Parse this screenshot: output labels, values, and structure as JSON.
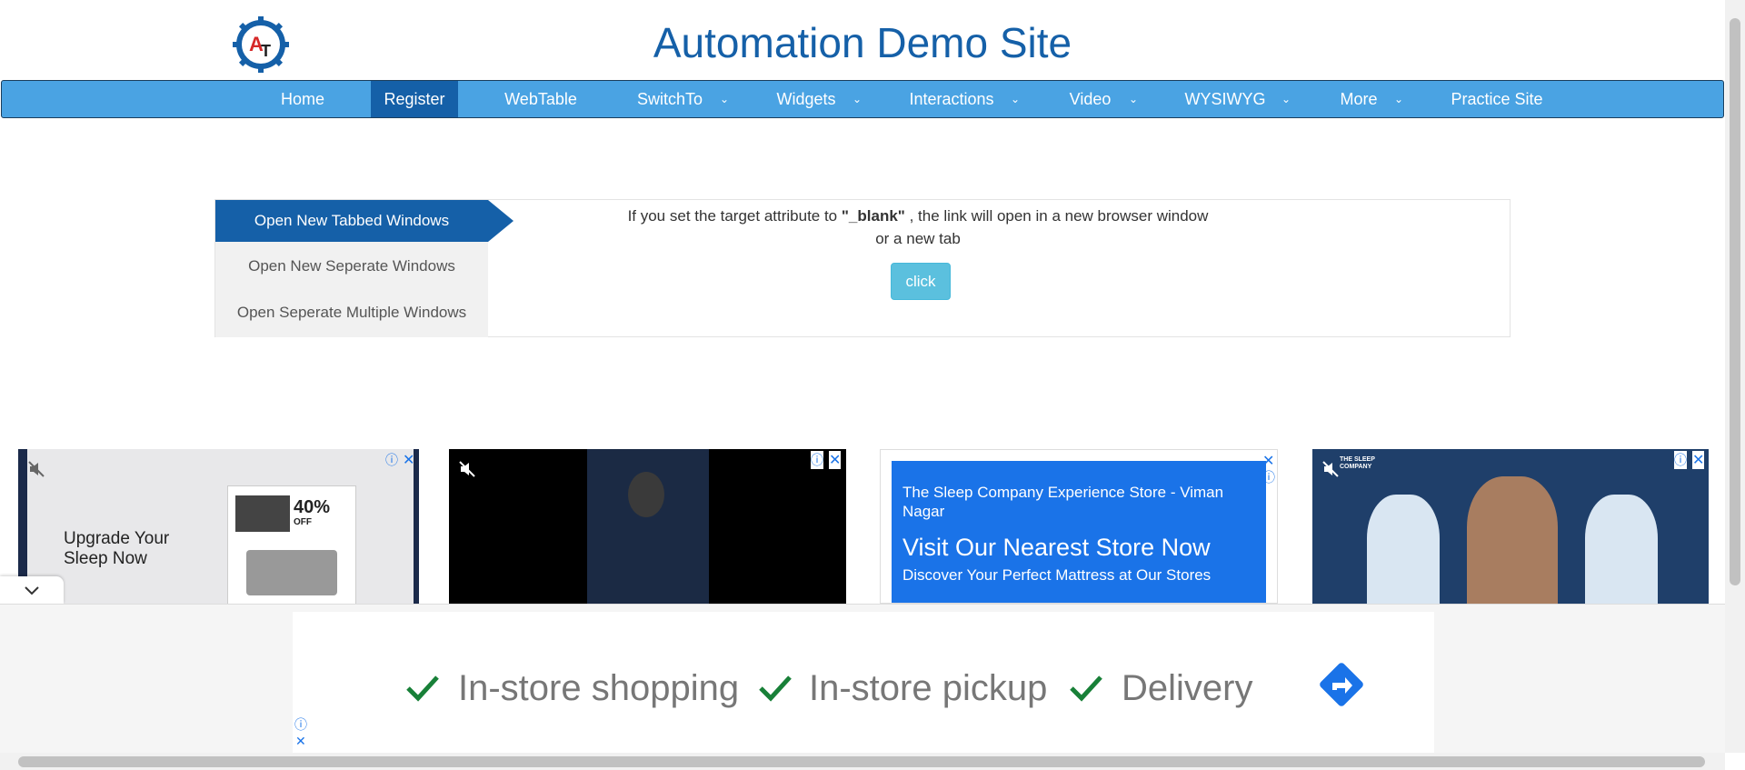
{
  "header": {
    "title": "Automation Demo Site",
    "logo_text": "AT"
  },
  "nav": {
    "items": [
      {
        "label": "Home",
        "dropdown": false
      },
      {
        "label": "Register",
        "dropdown": false,
        "active": true
      },
      {
        "label": "WebTable",
        "dropdown": false
      },
      {
        "label": "SwitchTo",
        "dropdown": true
      },
      {
        "label": "Widgets",
        "dropdown": true
      },
      {
        "label": "Interactions",
        "dropdown": true
      },
      {
        "label": "Video",
        "dropdown": true
      },
      {
        "label": "WYSIWYG",
        "dropdown": true
      },
      {
        "label": "More",
        "dropdown": true
      },
      {
        "label": "Practice Site",
        "dropdown": false
      }
    ]
  },
  "windows_tabs": {
    "items": [
      {
        "label": "Open New Tabbed Windows",
        "active": true
      },
      {
        "label": "Open New Seperate Windows"
      },
      {
        "label": "Open Seperate Multiple Windows"
      }
    ]
  },
  "content": {
    "desc_before": "If you set the target attribute to ",
    "desc_bold": "\"_blank\"",
    "desc_after": " , the link will open in a new browser window",
    "desc_line2": "or a new tab",
    "button_label": "click"
  },
  "ads": {
    "ad1_text": "Upgrade Your Sleep Now",
    "ad1_promo": "40%",
    "ad1_promo_sub": "OFF",
    "ad3_title": "The Sleep Company Experience Store - Viman Nagar",
    "ad3_headline": "Visit Our Nearest Store Now",
    "ad3_sub": "Discover Your Perfect Mattress at Our Stores",
    "ad4_brand": "THE SLEEP COMPANY",
    "close_glyph": "✕",
    "info_glyph": "ⓘ"
  },
  "bottom_ad": {
    "features": [
      "In-store shopping",
      "In-store pickup",
      "Delivery"
    ]
  },
  "colors": {
    "brand_blue": "#1560a8",
    "nav_blue": "#4aa3e3",
    "button_cyan": "#5bc0de",
    "ad_blue": "#1a73e8",
    "check_green": "#188038"
  }
}
